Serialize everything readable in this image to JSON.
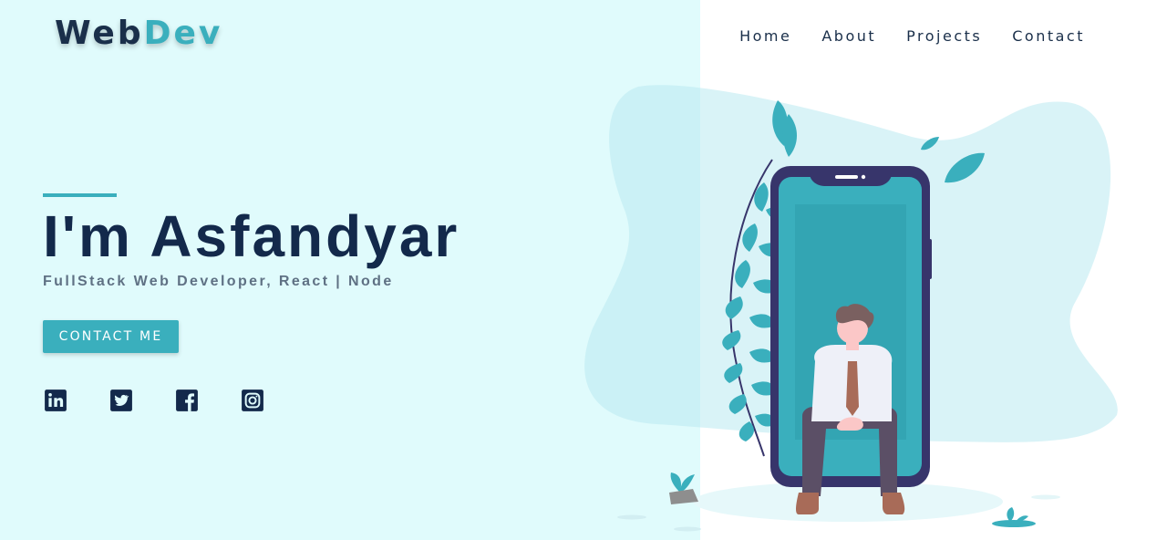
{
  "brand": {
    "part1": "Web",
    "part2": "Dev"
  },
  "nav": [
    {
      "label": "Home"
    },
    {
      "label": "About"
    },
    {
      "label": "Projects"
    },
    {
      "label": "Contact"
    }
  ],
  "hero": {
    "heading": "I'm Asfandyar",
    "subtitle": "FullStack Web Developer, React | Node",
    "cta_label": "CONTACT ME"
  },
  "socials": [
    {
      "icon": "linkedin-icon"
    },
    {
      "icon": "twitter-icon"
    },
    {
      "icon": "facebook-icon"
    },
    {
      "icon": "instagram-icon"
    }
  ],
  "colors": {
    "left_background": "#e0fbfc",
    "accent": "#3aafbd",
    "text_dark": "#13294b",
    "subtitle": "#5f7184",
    "phone_frame": "#37356b"
  }
}
